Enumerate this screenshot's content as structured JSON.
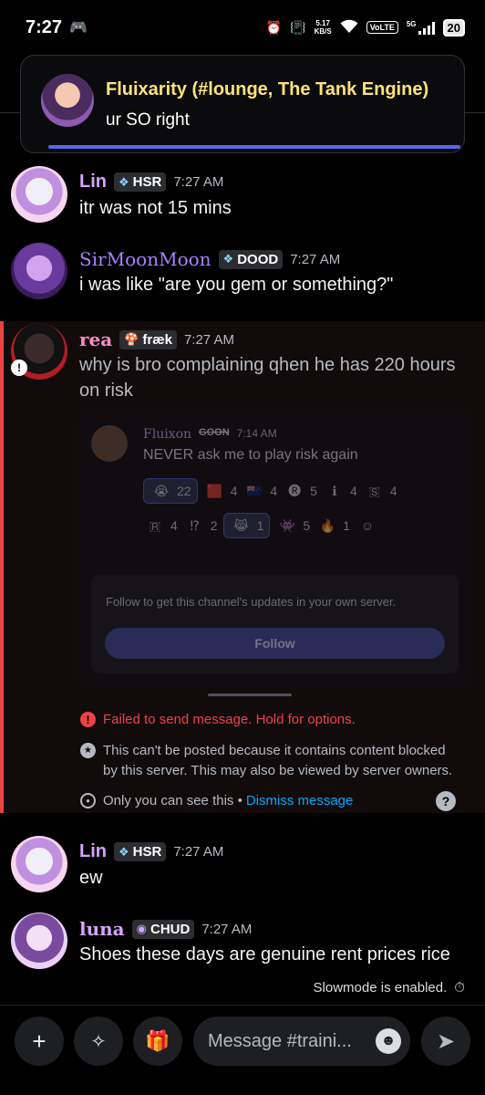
{
  "status_bar": {
    "time": "7:27",
    "net_speed_value": "5.17",
    "net_speed_unit": "KB/S",
    "volte": "VoLTE",
    "network": "5G",
    "battery": "20"
  },
  "notification": {
    "title": "Fluixarity (#lounge, The Tank Engine)",
    "body": "ur SO right"
  },
  "messages": [
    {
      "username": "Lin",
      "name_color": "#d7a3ff",
      "tag": "HSR",
      "tag_icon": "sparkle",
      "time": "7:27 AM",
      "text": "itr was not 15 mins"
    },
    {
      "username": "SirMoonMoon",
      "name_color": "#a784ff",
      "tag": "DOOD",
      "tag_icon": "sparkle",
      "time": "7:27 AM",
      "text": "i was like \"are you gem or something?\""
    },
    {
      "username": "rea",
      "name_color": "#ff8cc6",
      "tag": "fræk",
      "tag_icon": "mushroom",
      "time": "7:27 AM",
      "text_line1": "why is bro complaining qhen he has 220 hours",
      "text_line2": "on risk"
    },
    {
      "username": "Lin",
      "name_color": "#d7a3ff",
      "tag": "HSR",
      "tag_icon": "sparkle",
      "time": "7:27 AM",
      "text": "ew"
    },
    {
      "username": "luna",
      "name_color": "#d7a3ff",
      "tag": "CHUD",
      "tag_icon": "shield",
      "time": "7:27 AM",
      "text": "Shoes these days are genuine rent prices rice"
    }
  ],
  "blocked_embed": {
    "author": "Fluixon",
    "tag": "GOON",
    "time": "7:14 AM",
    "text": "NEVER ask me to play risk again",
    "reactions_row1": [
      {
        "emoji": "😭",
        "count": "22",
        "selected": true
      },
      {
        "emoji": "🟥",
        "count": "4"
      },
      {
        "emoji": "🇳🇿",
        "count": "4"
      },
      {
        "emoji": "🅡",
        "count": "5"
      },
      {
        "emoji": "ℹ",
        "count": "4"
      },
      {
        "emoji": "🇸",
        "count": "4"
      }
    ],
    "reactions_row2": [
      {
        "emoji": "🇷",
        "count": "4"
      },
      {
        "emoji": "⁉",
        "count": "2"
      },
      {
        "emoji": "😹",
        "count": "1",
        "selected": true
      },
      {
        "emoji": "👾",
        "count": "5"
      },
      {
        "emoji": "🔥",
        "count": "1"
      },
      {
        "emoji": "☺",
        "count": ""
      }
    ],
    "follow_prompt": "Follow to get this channel's updates in your own server.",
    "follow_button": "Follow"
  },
  "error": {
    "failed": "Failed to send message. Hold for options.",
    "blocked_line1": "This can't be posted because it contains content blocked",
    "blocked_line2": "by this server. This may also be viewed by server owners.",
    "only_you": "Only you can see this •",
    "dismiss": "Dismiss message"
  },
  "slowmode": "Slowmode is enabled.",
  "composer": {
    "placeholder": "Message #traini..."
  },
  "colors": {
    "accent": "#5865f2",
    "danger": "#ed4245",
    "link": "#00a8fc",
    "notif_title": "#ffe27a"
  }
}
